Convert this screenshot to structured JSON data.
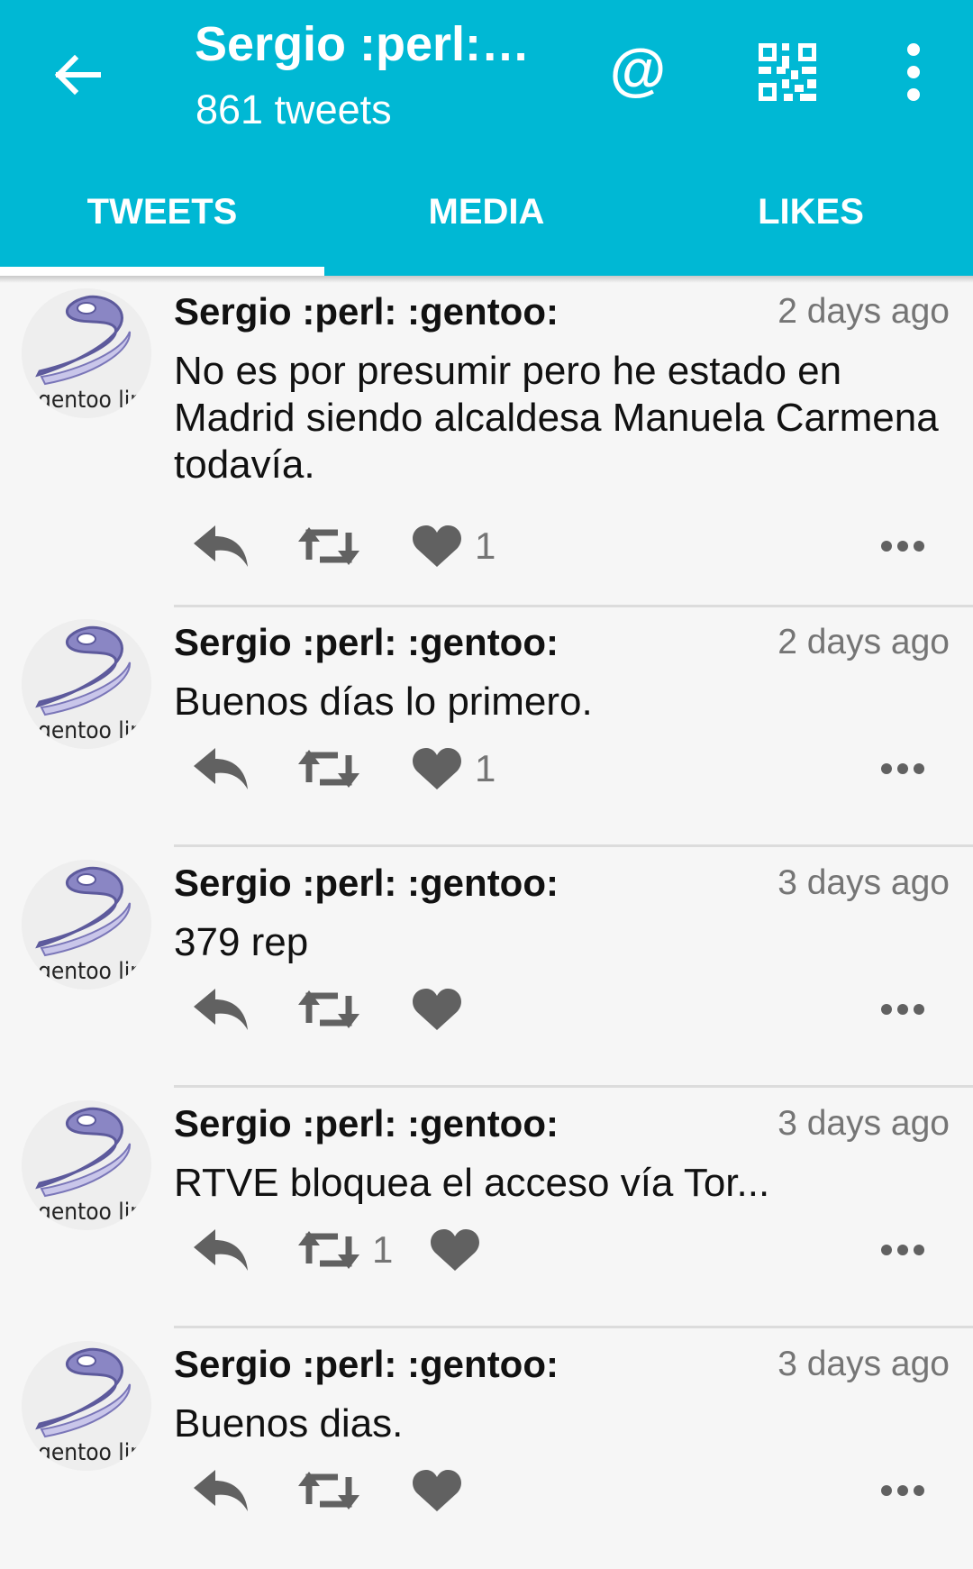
{
  "header": {
    "title": "Sergio :perl:…",
    "subtitle": "861 tweets",
    "back_icon": "arrow-left-icon",
    "mention_icon": "at-icon",
    "qr_icon": "qr-code-icon",
    "menu_icon": "more-vertical-icon",
    "color": "#00b8d4"
  },
  "tabs": [
    {
      "label": "TWEETS",
      "active": true
    },
    {
      "label": "MEDIA",
      "active": false
    },
    {
      "label": "LIKES",
      "active": false
    }
  ],
  "tweets": [
    {
      "author": "Sergio :perl: :gentoo:",
      "time": "2 days ago",
      "text": "No es por presumir pero he estado en Madrid siendo alcaldesa Manuela Carmena todavía.",
      "retweets": "",
      "likes": "1"
    },
    {
      "author": "Sergio :perl: :gentoo:",
      "time": "2 days ago",
      "text": "Buenos días lo primero.",
      "retweets": "",
      "likes": "1"
    },
    {
      "author": "Sergio :perl: :gentoo:",
      "time": "3 days ago",
      "text": "379 rep",
      "retweets": "",
      "likes": ""
    },
    {
      "author": "Sergio :perl: :gentoo:",
      "time": "3 days ago",
      "text": "RTVE bloquea el acceso vía Tor...",
      "retweets": "1",
      "likes": ""
    },
    {
      "author": "Sergio :perl: :gentoo:",
      "time": "3 days ago",
      "text": "Buenos dias.",
      "retweets": "",
      "likes": ""
    }
  ],
  "icons": {
    "reply": "reply-icon",
    "retweet": "retweet-icon",
    "like": "heart-icon",
    "more": "more-horizontal-icon",
    "avatar": "gentoo-logo-avatar"
  },
  "avatar_text": "gentoo linux"
}
